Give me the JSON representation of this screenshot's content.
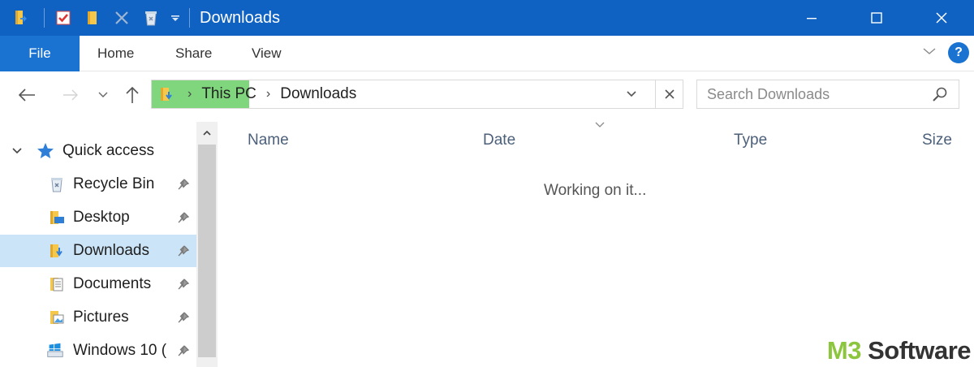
{
  "window": {
    "title": "Downloads",
    "controls": [
      "minimize",
      "maximize",
      "close"
    ]
  },
  "quick_access_toolbar": {
    "icons": [
      "folder-icon",
      "properties-check-icon",
      "new-folder-icon",
      "delete-x-icon",
      "recycle-bin-icon",
      "customize-dropdown-icon"
    ]
  },
  "ribbon": {
    "file_label": "File",
    "tabs": [
      {
        "label": "Home"
      },
      {
        "label": "Share"
      },
      {
        "label": "View"
      }
    ],
    "help_label": "?"
  },
  "address_bar": {
    "breadcrumbs": [
      "This PC",
      "Downloads"
    ]
  },
  "search": {
    "placeholder": "Search Downloads"
  },
  "nav_pane": {
    "group_label": "Quick access",
    "items": [
      {
        "label": "Recycle Bin",
        "icon": "recycle-bin-icon",
        "pinned": true
      },
      {
        "label": "Desktop",
        "icon": "desktop-folder-icon",
        "pinned": true
      },
      {
        "label": "Downloads",
        "icon": "downloads-folder-icon",
        "pinned": true,
        "selected": true
      },
      {
        "label": "Documents",
        "icon": "documents-icon",
        "pinned": true
      },
      {
        "label": "Pictures",
        "icon": "pictures-icon",
        "pinned": true
      },
      {
        "label": "Windows 10 (",
        "icon": "drive-icon",
        "pinned": true
      }
    ]
  },
  "content": {
    "columns": [
      {
        "label": "Name"
      },
      {
        "label": "Date"
      },
      {
        "label": "Type"
      },
      {
        "label": "Size"
      }
    ],
    "status": "Working on it..."
  },
  "watermark": {
    "part1": "M3",
    "part2": " Software"
  },
  "colors": {
    "titlebar": "#0f62c2",
    "file_tab": "#1a73d1",
    "selection": "#cce4f7",
    "address_progress": "#7fd67c",
    "watermark_green": "#8cc63f"
  }
}
